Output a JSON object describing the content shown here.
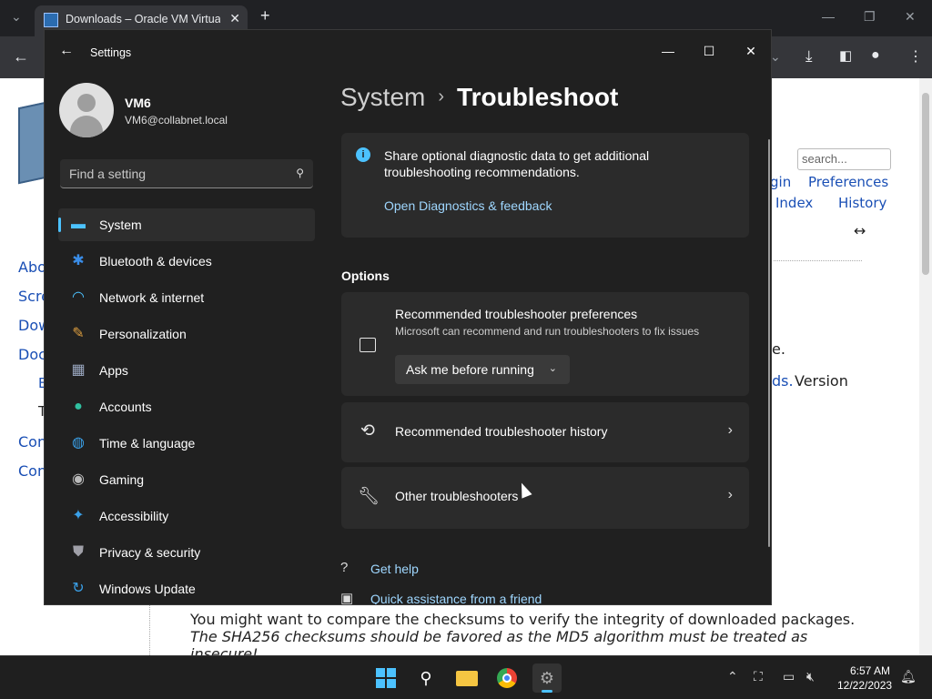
{
  "browser": {
    "tab_title": "Downloads – Oracle VM VirtualBox",
    "new_tab": "+",
    "tab_close": "✕",
    "webpage": {
      "search_placeholder": "search...",
      "links": {
        "login_partial": "gin",
        "preferences": "Preferences",
        "index": "Index",
        "history": "History",
        "about": "Abo",
        "screenshots": "Scre",
        "downloads": "Dow",
        "documentation": "Doc",
        "doc_sub": "E",
        "community": "Con",
        "contribute": "Con",
        "downloads_partial": "ds."
      },
      "resize_arrow": "↔",
      "text": {
        "e_dot": "e.",
        "version": "Version",
        "sub_t": "T",
        "checksums": "You might want to compare the checksums to verify the integrity of downloaded packages.",
        "sha_line": "The SHA256 checksums should be favored as the MD5 algorithm must be treated as",
        "insecure": "insecure!"
      }
    }
  },
  "settings": {
    "app_title": "Settings",
    "user": {
      "name": "VM6",
      "email": "VM6@collabnet.local"
    },
    "find_placeholder": "Find a setting",
    "nav": [
      {
        "label": "System",
        "icon": "system-icon",
        "selected": true,
        "color": "#4cc2ff"
      },
      {
        "label": "Bluetooth & devices",
        "icon": "bluetooth-icon",
        "color": "#3a8de8"
      },
      {
        "label": "Network & internet",
        "icon": "wifi-icon",
        "color": "#4cc2ff"
      },
      {
        "label": "Personalization",
        "icon": "brush-icon",
        "color": "#e0a040"
      },
      {
        "label": "Apps",
        "icon": "apps-icon",
        "color": "#9aa7c0"
      },
      {
        "label": "Accounts",
        "icon": "person-icon",
        "color": "#30c0a0"
      },
      {
        "label": "Time & language",
        "icon": "globe-icon",
        "color": "#3aa0e8"
      },
      {
        "label": "Gaming",
        "icon": "gamepad-icon",
        "color": "#bbbbbb"
      },
      {
        "label": "Accessibility",
        "icon": "accessibility-icon",
        "color": "#3aa0e8"
      },
      {
        "label": "Privacy & security",
        "icon": "shield-icon",
        "color": "#a0a0a8"
      },
      {
        "label": "Windows Update",
        "icon": "update-icon",
        "color": "#3aa0e8"
      }
    ],
    "breadcrumb": {
      "parent": "System",
      "separator": "›",
      "current": "Troubleshoot"
    },
    "info": {
      "text": "Share optional diagnostic data to get additional troubleshooting recommendations.",
      "link": "Open Diagnostics & feedback"
    },
    "options_header": "Options",
    "pref": {
      "title": "Recommended troubleshooter preferences",
      "description": "Microsoft can recommend and run troubleshooters to fix issues",
      "selected": "Ask me before running"
    },
    "history_label": "Recommended troubleshooter history",
    "other_label": "Other troubleshooters",
    "help": {
      "get_help": "Get help",
      "quick_assist": "Quick assistance from a friend"
    }
  },
  "taskbar": {
    "time": "6:57 AM",
    "date": "12/22/2023"
  },
  "accent": "#4cc2ff",
  "link_color": "#9fd7ff"
}
